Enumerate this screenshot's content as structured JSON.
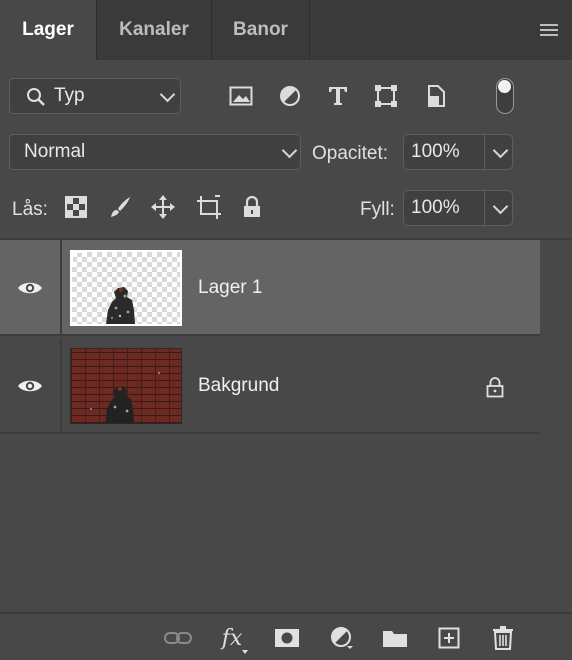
{
  "tabs": [
    {
      "label": "Lager",
      "active": true
    },
    {
      "label": "Kanaler",
      "active": false
    },
    {
      "label": "Banor",
      "active": false
    }
  ],
  "filter": {
    "value": "Typ",
    "icon": "search-icon"
  },
  "filter_icons": [
    "image-filter-icon",
    "adjustment-filter-icon",
    "type-filter-icon",
    "shape-filter-icon",
    "smart-object-filter-icon",
    "filter-toggle-icon"
  ],
  "blend": {
    "mode": "Normal",
    "opacity_label": "Opacitet:",
    "opacity_value": "100%"
  },
  "lock": {
    "label": "Lås:",
    "fill_label": "Fyll:",
    "fill_value": "100%",
    "icons": [
      "lock-transparent-pixels-icon",
      "lock-image-pixels-icon",
      "lock-position-icon",
      "lock-artboard-icon",
      "lock-all-icon"
    ]
  },
  "layers": [
    {
      "name": "Lager 1",
      "visible": true,
      "selected": true,
      "locked": false
    },
    {
      "name": "Bakgrund",
      "visible": true,
      "selected": false,
      "locked": true
    }
  ],
  "bottom_icons": [
    "link-layers-icon",
    "fx-icon",
    "layer-mask-icon",
    "adjustment-layer-icon",
    "group-folder-icon",
    "new-layer-icon",
    "trash-icon"
  ],
  "fx_label": "fx"
}
